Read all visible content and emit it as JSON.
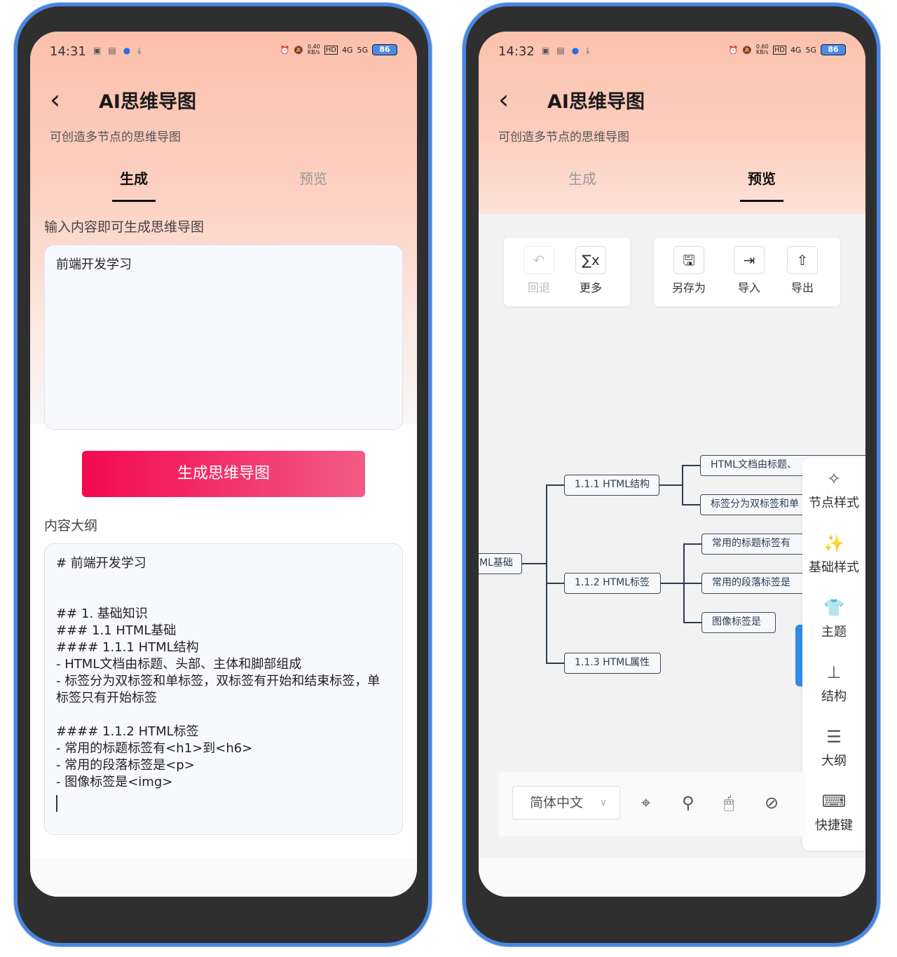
{
  "left_phone": {
    "status": {
      "time": "14:31",
      "net_speed": "0.40\nKB/s",
      "signal_a": "4G",
      "signal_b": "5G",
      "battery": "86"
    },
    "header": {
      "back": "<",
      "title": "AI思维导图",
      "subtitle": "可创造多节点的思维导图"
    },
    "tabs": [
      {
        "label": "生成"
      },
      {
        "label": "预览"
      }
    ],
    "input_label": "输入内容即可生成思维导图",
    "input_value": "前端开发学习",
    "generate_button": "生成思维导图",
    "outline_label": "内容大纲",
    "outline_lines": [
      "# 前端开发学习",
      "",
      "",
      "## 1. 基础知识",
      "### 1.1 HTML基础",
      "#### 1.1.1 HTML结构",
      "- HTML文档由标题、头部、主体和脚部组成",
      "- 标签分为双标签和单标签，双标签有开始和结束标签，单标签只有开始标签",
      "",
      "#### 1.1.2 HTML标签",
      "- 常用的标题标签有<h1>到<h6>",
      "- 常用的段落标签是<p>",
      "- 图像标签是<img>"
    ]
  },
  "right_phone": {
    "status": {
      "time": "14:32",
      "net_speed": "0.60\nKB/s",
      "signal_a": "4G",
      "signal_b": "5G",
      "battery": "86"
    },
    "header": {
      "back": "<",
      "title": "AI思维导图",
      "subtitle": "可创造多节点的思维导图"
    },
    "tabs": [
      {
        "label": "生成"
      },
      {
        "label": "预览"
      }
    ],
    "toolbar_left": [
      {
        "label": "回退",
        "icon": "undo-icon",
        "glyph": "↶",
        "disabled": true
      },
      {
        "label": "更多",
        "icon": "formula-icon",
        "glyph": "∑x",
        "disabled": false
      }
    ],
    "toolbar_right": [
      {
        "label": "另存为",
        "icon": "save-as-icon",
        "glyph": "🖫"
      },
      {
        "label": "导入",
        "icon": "import-icon",
        "glyph": "⇥"
      },
      {
        "label": "导出",
        "icon": "export-icon",
        "glyph": "⇧"
      }
    ],
    "mindmap": {
      "root": "ML基础",
      "l1": [
        "1.1.1 HTML结构",
        "1.1.2 HTML标签",
        "1.1.3 HTML属性"
      ],
      "l2a": [
        "HTML文档由标题、",
        "标签分为双标签和单"
      ],
      "l2b": [
        "常用的标题标签有",
        "常用的段落标签是",
        "图像标签是"
      ]
    },
    "side_panel": [
      {
        "label": "节点样式",
        "icon": "node-style-icon",
        "glyph": "✧"
      },
      {
        "label": "基础样式",
        "icon": "magic-wand-icon",
        "glyph": "✨"
      },
      {
        "label": "主题",
        "icon": "shirt-icon",
        "glyph": "👕"
      },
      {
        "label": "结构",
        "icon": "structure-icon",
        "glyph": "⊥"
      },
      {
        "label": "大纲",
        "icon": "outline-icon",
        "glyph": "☰"
      },
      {
        "label": "快捷键",
        "icon": "keyboard-icon",
        "glyph": "⌨"
      }
    ],
    "bottom_bar": {
      "language": "简体中文",
      "icons": [
        {
          "icon": "locate-icon",
          "glyph": "⌖"
        },
        {
          "icon": "search-icon",
          "glyph": "⚲"
        },
        {
          "icon": "mouse-icon",
          "glyph": "🖱"
        },
        {
          "icon": "compass-icon",
          "glyph": "⊘"
        }
      ]
    }
  },
  "colors": {
    "accent_start": "#f30a4e",
    "accent_end": "#f25b84",
    "header_top": "#fbc2ad",
    "frame": "#4a86e0",
    "side_tab": "#2f8be6"
  }
}
